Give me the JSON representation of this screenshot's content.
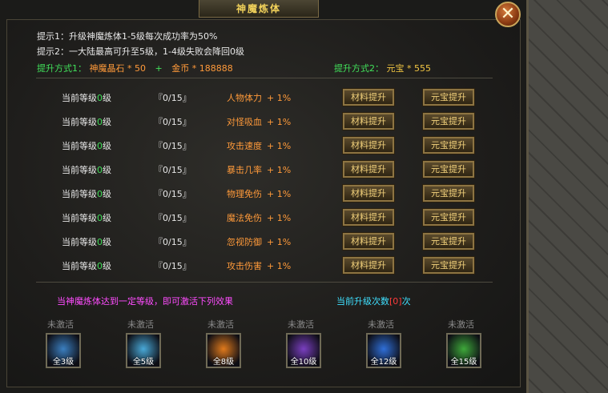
{
  "window": {
    "title": "神魔炼体",
    "close_label": "✕"
  },
  "hints": {
    "line1": "提示1：升级神魔炼体1-5级每次成功率为50%",
    "line2": "提示2：一大陆最高可升至5级，1-4级失败会降回0级",
    "method1_label": "提升方式1：",
    "method1_item1": "神魔晶石 * 50",
    "method1_plus": "+",
    "method1_item2": "金币 * 188888",
    "method2_label": "提升方式2：",
    "method2_item": "元宝 * 555"
  },
  "rows": [
    {
      "level_prefix": "当前等级",
      "level": "0",
      "level_suffix": "级",
      "progress": "『0/15』",
      "attr": "人物体力",
      "bonus": "+ 1%",
      "btn1": "材料提升",
      "btn2": "元宝提升"
    },
    {
      "level_prefix": "当前等级",
      "level": "0",
      "level_suffix": "级",
      "progress": "『0/15』",
      "attr": "对怪吸血",
      "bonus": "+ 1%",
      "btn1": "材料提升",
      "btn2": "元宝提升"
    },
    {
      "level_prefix": "当前等级",
      "level": "0",
      "level_suffix": "级",
      "progress": "『0/15』",
      "attr": "攻击速度",
      "bonus": "+ 1%",
      "btn1": "材料提升",
      "btn2": "元宝提升"
    },
    {
      "level_prefix": "当前等级",
      "level": "0",
      "level_suffix": "级",
      "progress": "『0/15』",
      "attr": "暴击几率",
      "bonus": "+ 1%",
      "btn1": "材料提升",
      "btn2": "元宝提升"
    },
    {
      "level_prefix": "当前等级",
      "level": "0",
      "level_suffix": "级",
      "progress": "『0/15』",
      "attr": "物理免伤",
      "bonus": "+ 1%",
      "btn1": "材料提升",
      "btn2": "元宝提升"
    },
    {
      "level_prefix": "当前等级",
      "level": "0",
      "level_suffix": "级",
      "progress": "『0/15』",
      "attr": "魔法免伤",
      "bonus": "+ 1%",
      "btn1": "材料提升",
      "btn2": "元宝提升"
    },
    {
      "level_prefix": "当前等级",
      "level": "0",
      "level_suffix": "级",
      "progress": "『0/15』",
      "attr": "忽视防御",
      "bonus": "+ 1%",
      "btn1": "材料提升",
      "btn2": "元宝提升"
    },
    {
      "level_prefix": "当前等级",
      "level": "0",
      "level_suffix": "级",
      "progress": "『0/15』",
      "attr": "攻击伤害",
      "bonus": "+ 1%",
      "btn1": "材料提升",
      "btn2": "元宝提升"
    }
  ],
  "footer": {
    "activate_hint": "当神魔炼体达到一定等级，即可激活下列效果",
    "upgrade_count_prefix": "当前升级次数",
    "upgrade_count": "[0]",
    "upgrade_count_suffix": "次"
  },
  "rewards": [
    {
      "status": "未激活",
      "label": "全3级",
      "icon": "blade-slash-icon",
      "color": "#3b7fc0"
    },
    {
      "status": "未激活",
      "label": "全5级",
      "icon": "ice-burst-icon",
      "color": "#49a9d8"
    },
    {
      "status": "未激活",
      "label": "全8级",
      "icon": "fire-figure-icon",
      "color": "#e07a1c"
    },
    {
      "status": "未激活",
      "label": "全10级",
      "icon": "purple-ring-icon",
      "color": "#7a3fc0"
    },
    {
      "status": "未激活",
      "label": "全12级",
      "icon": "water-vortex-icon",
      "color": "#2f6fd8"
    },
    {
      "status": "未激活",
      "label": "全15级",
      "icon": "green-arm-icon",
      "color": "#3ea83a"
    }
  ]
}
